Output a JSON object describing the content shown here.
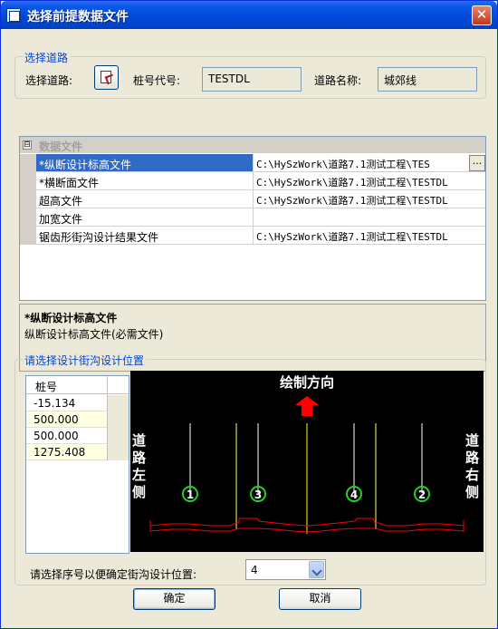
{
  "window": {
    "title": "选择前提数据文件",
    "close_glyph": "✕"
  },
  "road_group": {
    "legend": "选择道路",
    "select_road_label": "选择道路:",
    "station_code_label": "桩号代号:",
    "station_code_value": "TESTDL",
    "road_name_label": "道路名称:",
    "road_name_value": "城郊线"
  },
  "data_grid": {
    "expander": "⊟",
    "category": "数据文件",
    "ellipsis": "...",
    "rows": [
      {
        "name": "*纵断设计标高文件",
        "value": "C:\\HySzWork\\道路7.1测试工程\\TES",
        "selected": true
      },
      {
        "name": "*横断面文件",
        "value": "C:\\HySzWork\\道路7.1测试工程\\TESTDL"
      },
      {
        "name": "超高文件",
        "value": "C:\\HySzWork\\道路7.1测试工程\\TESTDL"
      },
      {
        "name": "加宽文件",
        "value": ""
      },
      {
        "name": "锯齿形街沟设计结果文件",
        "value": "C:\\HySzWork\\道路7.1测试工程\\TESTDL"
      }
    ]
  },
  "description": {
    "title": "*纵断设计标高文件",
    "text": "纵断设计标高文件(必需文件)"
  },
  "position_group": {
    "legend": "请选择设计街沟设计位置",
    "table_header": "桩号",
    "stations": [
      "-15.134",
      "500.000",
      "500.000",
      "1275.408"
    ],
    "diagram": {
      "direction_label": "绘制方向",
      "left_label": "道路左侧",
      "right_label": "道路右侧",
      "markers": [
        "①",
        "③",
        "④",
        "②"
      ],
      "colors": {
        "background": "#000000",
        "arrow": "#ff0000",
        "marker": "#1fd41f",
        "profile": "#ff0000",
        "center": "#ffff00"
      }
    },
    "select_label": "请选择序号以便确定街沟设计位置:",
    "select_value": "4"
  },
  "buttons": {
    "ok": "确定",
    "cancel": "取消"
  }
}
